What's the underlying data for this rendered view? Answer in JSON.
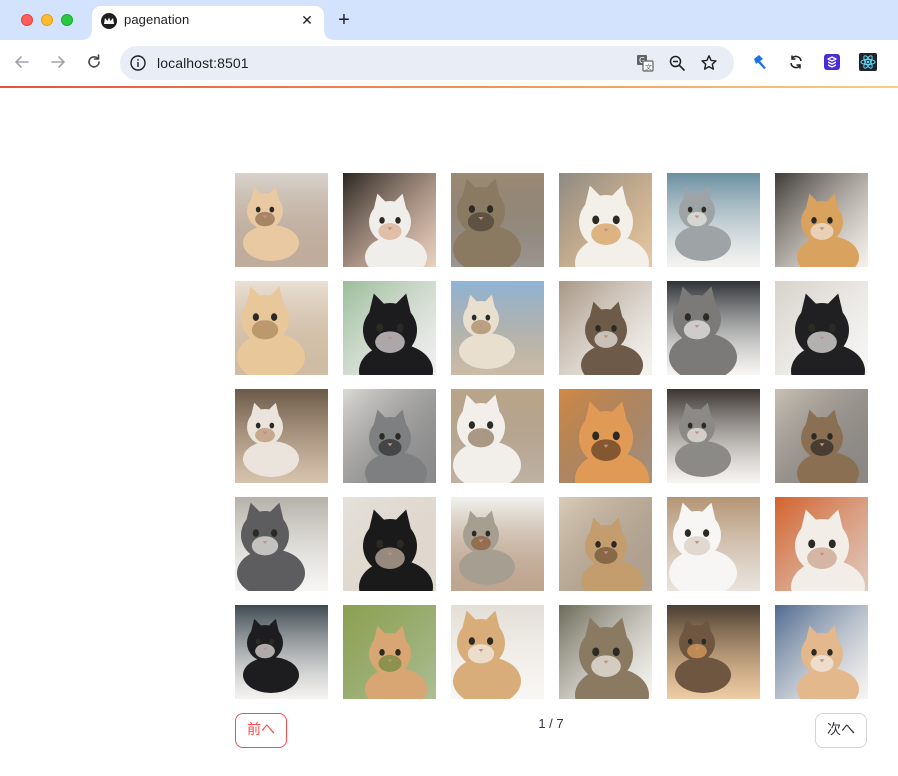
{
  "browser": {
    "tab_title": "pagenation",
    "tab_close": "✕",
    "new_tab": "+",
    "url": "localhost:8501"
  },
  "pagination": {
    "prev_label": "前へ",
    "next_label": "次へ",
    "page_indicator": "1 / 7",
    "current_page": 1,
    "total_pages": 7
  },
  "gallery": {
    "columns": 6,
    "images": [
      {
        "subject": "cat-tower",
        "bg": "#d9d3cc",
        "fur": "#e8c9a2",
        "accent": "#8c6a4c"
      },
      {
        "subject": "white-cat-petted",
        "bg": "#2a2622",
        "fur": "#f0eeeb",
        "accent": "#d9a98a"
      },
      {
        "subject": "tabby-closeup",
        "bg": "#9b8a73",
        "fur": "#8a7a62",
        "accent": "#4b4136"
      },
      {
        "subject": "scottish-fold",
        "bg": "#8d8a85",
        "fur": "#f3efe9",
        "accent": "#d39a56"
      },
      {
        "subject": "grey-tabby-lying",
        "bg": "#6a8fa1",
        "fur": "#9ea3a6",
        "accent": "#eceae6"
      },
      {
        "subject": "orange-cat",
        "bg": "#3e3a36",
        "fur": "#d9a25e",
        "accent": "#efe6da"
      },
      {
        "subject": "cream-cat",
        "bg": "#e9e0d4",
        "fur": "#e8c79a",
        "accent": "#a9855a"
      },
      {
        "subject": "black-cat-blanket",
        "bg": "#9bbd9a",
        "fur": "#1c1c1e",
        "accent": "#e9e4e6"
      },
      {
        "subject": "calico-sky",
        "bg": "#8fb4d6",
        "fur": "#e9dfcf",
        "accent": "#a2855f"
      },
      {
        "subject": "tabby-white",
        "bg": "#a79684",
        "fur": "#6e5a48",
        "accent": "#efece7"
      },
      {
        "subject": "tabby-stare",
        "bg": "#2f3236",
        "fur": "#7c7a78",
        "accent": "#f1efec"
      },
      {
        "subject": "tuxedo-standing",
        "bg": "#d6d2cb",
        "fur": "#202022",
        "accent": "#f2f0ed"
      },
      {
        "subject": "sleeping-white",
        "bg": "#6b5a4a",
        "fur": "#eae4dc",
        "accent": "#b5926c"
      },
      {
        "subject": "silver-tabby",
        "bg": "#dcdad6",
        "fur": "#7e7f80",
        "accent": "#2c2c2e"
      },
      {
        "subject": "white-floor",
        "bg": "#b9a58a",
        "fur": "#f2efea",
        "accent": "#8a7458"
      },
      {
        "subject": "orange-tilted",
        "bg": "#d18a46",
        "fur": "#e19a55",
        "accent": "#5b3a1f"
      },
      {
        "subject": "fold-box",
        "bg": "#3b3431",
        "fur": "#8c8a86",
        "accent": "#f0ece6"
      },
      {
        "subject": "tabby-window",
        "bg": "#c9c1b5",
        "fur": "#8a6f52",
        "accent": "#2e2824"
      },
      {
        "subject": "grey-white-cushion",
        "bg": "#b4b1a9",
        "fur": "#5d5d60",
        "accent": "#f0eeea"
      },
      {
        "subject": "black-leg",
        "bg": "#e4e1dc",
        "fur": "#1b1a1a",
        "accent": "#c9bba8"
      },
      {
        "subject": "grey-cat-box",
        "bg": "#f1f3f0",
        "fur": "#a79e92",
        "accent": "#8a5b34"
      },
      {
        "subject": "cat-scratcher",
        "bg": "#d9cdb8",
        "fur": "#c49d6e",
        "accent": "#6e5238"
      },
      {
        "subject": "white-sleeping",
        "bg": "#b49474",
        "fur": "#f7f6f4",
        "accent": "#d7ccbf"
      },
      {
        "subject": "fluffy-white",
        "bg": "#d4622b",
        "fur": "#f2ede6",
        "accent": "#c99c87"
      },
      {
        "subject": "tuxedo-napping",
        "bg": "#3e4a52",
        "fur": "#1d1d1f",
        "accent": "#ece9e5"
      },
      {
        "subject": "orange-tabby-face",
        "bg": "#8da050",
        "fur": "#d7a672",
        "accent": "#6a8a3e"
      },
      {
        "subject": "cream-bath",
        "bg": "#e3ded6",
        "fur": "#d8ad7a",
        "accent": "#f4f1ec"
      },
      {
        "subject": "maine-coon",
        "bg": "#6c6a58",
        "fur": "#8a7a62",
        "accent": "#f3f0ea"
      },
      {
        "subject": "brown-tabby-dark",
        "bg": "#4a3e33",
        "fur": "#6e5641",
        "accent": "#e0a35c"
      },
      {
        "subject": "cream-blanket",
        "bg": "#4f6a8f",
        "fur": "#e3b88c",
        "accent": "#f2ede6"
      }
    ]
  }
}
